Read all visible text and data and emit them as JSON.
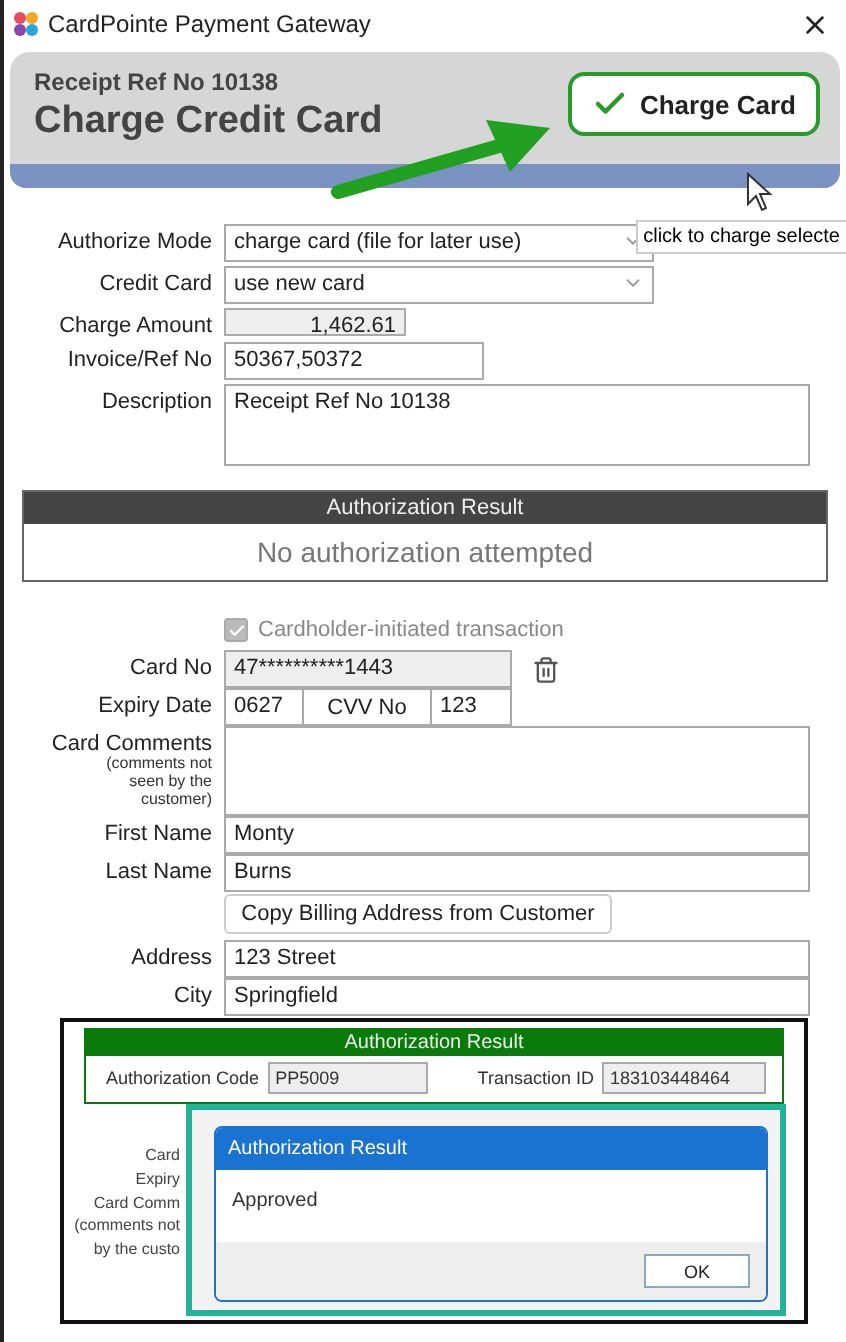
{
  "window": {
    "title": "CardPointe Payment Gateway"
  },
  "header": {
    "subtitle": "Receipt Ref No 10138",
    "title": "Charge Credit Card",
    "button": "Charge Card",
    "tooltip": "click to charge selecte"
  },
  "fields": [
    {
      "kind": "select",
      "label": "Authorize Mode",
      "value": "charge card (file for later use)"
    },
    {
      "kind": "select",
      "label": "Credit Card",
      "value": "use new card"
    },
    {
      "kind": "amount",
      "label": "Charge Amount",
      "value": "1,462.61"
    },
    {
      "kind": "short",
      "label": "Invoice/Ref No",
      "value": "50367,50372"
    },
    {
      "kind": "textarea",
      "label": "Description",
      "value": "Receipt Ref No 10138"
    }
  ],
  "auth_result": {
    "title": "Authorization Result",
    "message": "No authorization attempted"
  },
  "cardholder_initiated": {
    "label": "Cardholder-initiated transaction",
    "checked": true,
    "disabled": true
  },
  "card_fields": [
    {
      "kind": "card_no",
      "label": "Card No",
      "value": "47**********1443"
    },
    {
      "kind": "expiry",
      "label": "Expiry Date",
      "value": "0627",
      "cvv_label": "CVV No",
      "cvv_value": "123"
    },
    {
      "kind": "textarea",
      "label": "Card Comments",
      "note": "(comments not seen by the customer)"
    },
    {
      "kind": "text",
      "label": "First Name",
      "value": "Monty"
    },
    {
      "kind": "text",
      "label": "Last Name",
      "value": "Burns"
    }
  ],
  "copy_button": "Copy Billing Address from Customer",
  "address_fields": [
    {
      "kind": "text",
      "label": "Address",
      "value": "123 Street"
    },
    {
      "kind": "text",
      "label": "City",
      "value": "Springfield"
    }
  ],
  "inset": {
    "result": {
      "title": "Authorization Result",
      "code_label": "Authorization Code",
      "code": "PP5009",
      "tid_label": "Transaction ID",
      "tid": "183103448464"
    },
    "behind_labels": [
      "Card",
      "Expiry",
      "Card Comm",
      "(comments not",
      "by the custo"
    ],
    "dialog": {
      "title": "Authorization Result",
      "message": "Approved",
      "button": "OK"
    }
  }
}
